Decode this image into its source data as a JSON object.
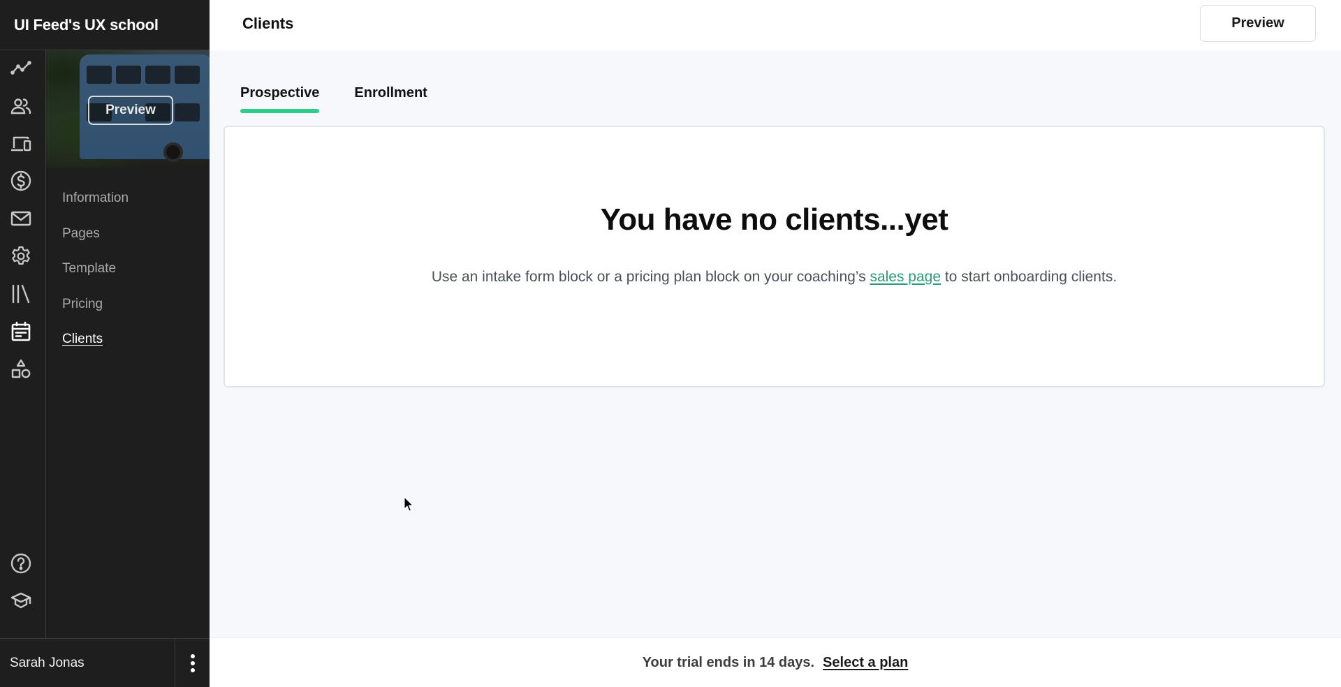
{
  "app": {
    "title": "UI Feed's UX school"
  },
  "rail": {
    "items": [
      {
        "name": "analytics",
        "icon": "trend-line-icon",
        "active": false
      },
      {
        "name": "people",
        "icon": "users-icon",
        "active": false
      },
      {
        "name": "devices",
        "icon": "devices-icon",
        "active": false
      },
      {
        "name": "payments",
        "icon": "dollar-circle-icon",
        "active": false
      },
      {
        "name": "email",
        "icon": "mail-icon",
        "active": false
      },
      {
        "name": "settings",
        "icon": "gear-icon",
        "active": false
      },
      {
        "name": "library",
        "icon": "library-icon",
        "active": false
      },
      {
        "name": "coaching",
        "icon": "calendar-icon",
        "active": true
      },
      {
        "name": "shapes",
        "icon": "shapes-icon",
        "active": false
      }
    ],
    "bottom_items": [
      {
        "name": "help",
        "icon": "help-circle-icon"
      },
      {
        "name": "academy",
        "icon": "graduation-cap-icon"
      }
    ]
  },
  "cover": {
    "preview_label": "Preview"
  },
  "subnav": {
    "items": [
      {
        "label": "Information",
        "active": false
      },
      {
        "label": "Pages",
        "active": false
      },
      {
        "label": "Template",
        "active": false
      },
      {
        "label": "Pricing",
        "active": false
      },
      {
        "label": "Clients",
        "active": true
      }
    ]
  },
  "user": {
    "name": "Sarah Jonas",
    "menu_icon": "kebab-menu-icon"
  },
  "header": {
    "title": "Clients",
    "preview_label": "Preview"
  },
  "tabs": [
    {
      "label": "Prospective",
      "active": true
    },
    {
      "label": "Enrollment",
      "active": false
    }
  ],
  "empty_state": {
    "title": "You have no clients...yet",
    "text_before": "Use an intake form block or a pricing plan block on your coaching’s ",
    "link": "sales page",
    "text_after": " to start onboarding clients."
  },
  "trial": {
    "message": "Your trial ends in 14 days.",
    "cta": "Select a plan"
  },
  "colors": {
    "accent": "#2ecc8a",
    "link": "#2a9d74",
    "sidebar_bg": "#1e1e1e",
    "page_bg": "#f7f8fb"
  }
}
